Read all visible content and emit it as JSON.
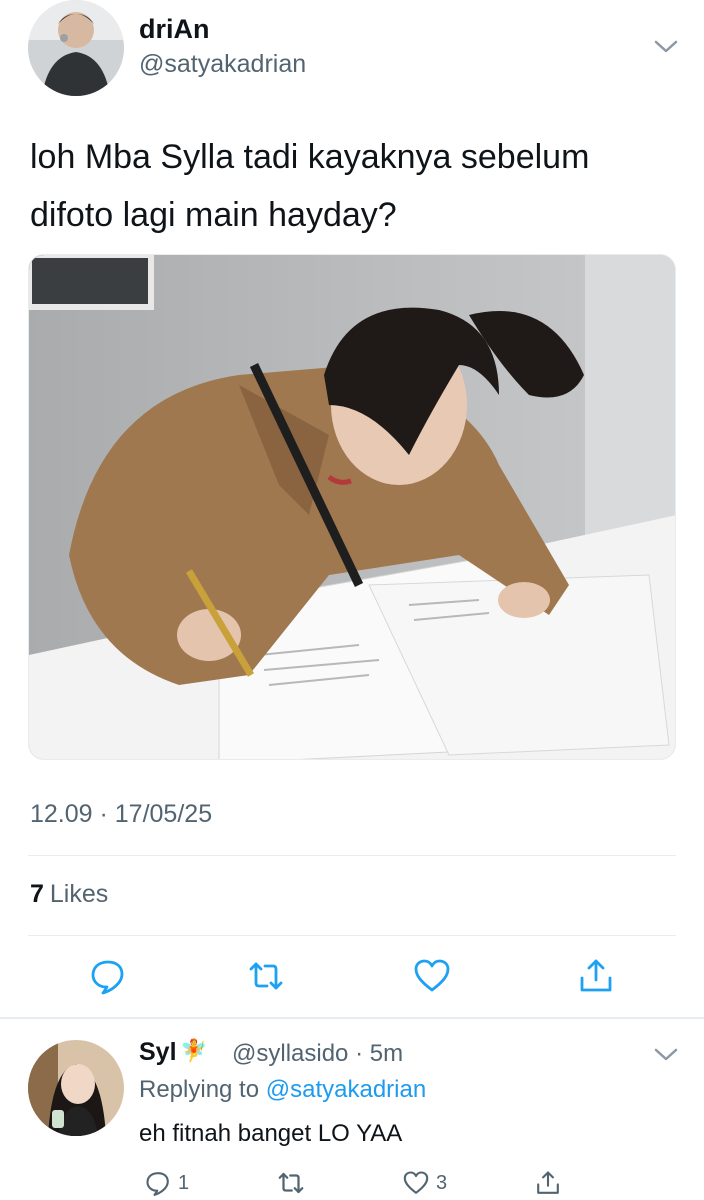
{
  "tweet": {
    "author_name": "driAn",
    "author_handle": "@satyakadrian",
    "text": "loh Mba Sylla tadi kayaknya sebelum difoto lagi main hayday?",
    "timestamp": "12.09 · 17/05/25",
    "likes_count": "7",
    "likes_label": "Likes",
    "avatar_icon": "profile-photo-man",
    "media_icon": "photo-woman-signing-papers",
    "actions": [
      {
        "name": "reply",
        "icon": "speech-bubble-icon"
      },
      {
        "name": "retweet",
        "icon": "retweet-arrows-icon"
      },
      {
        "name": "like",
        "icon": "heart-icon"
      },
      {
        "name": "share",
        "icon": "share-upload-icon"
      }
    ]
  },
  "reply": {
    "author_name": "Syl",
    "emoji": "🧚",
    "author_handle": "@syllasido",
    "time": "· 5m",
    "replying_prefix": "Replying to",
    "replying_to": "@satyakadrian",
    "text": "eh fitnah banget LO YAA",
    "reply_count": "1",
    "like_count": "3"
  },
  "colors": {
    "text": "#0f1419",
    "muted": "#536471",
    "link": "#1d9bf0",
    "divider": "#e6ecf0"
  }
}
